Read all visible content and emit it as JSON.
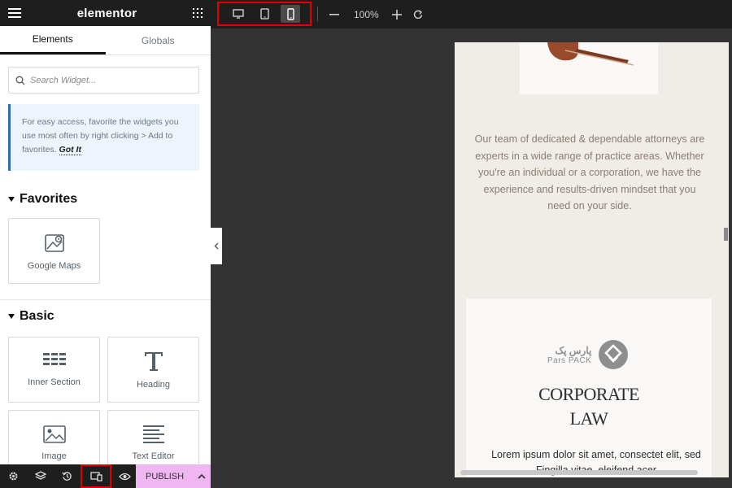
{
  "app": {
    "logo": "elementor"
  },
  "panel": {
    "tabs": [
      "Elements",
      "Globals"
    ],
    "search_placeholder": "Search Widget...",
    "notice": {
      "text": "For easy access, favorite the widgets you use most often by right clicking > Add to favorites.",
      "link": "Got It"
    },
    "favorites": {
      "title": "Favorites",
      "widgets": [
        {
          "label": "Google Maps",
          "icon": "google-maps-icon"
        }
      ]
    },
    "basic": {
      "title": "Basic",
      "widgets": [
        {
          "label": "Inner Section",
          "icon": "inner-section-icon"
        },
        {
          "label": "Heading",
          "icon": "heading-icon"
        },
        {
          "label": "Image",
          "icon": "image-icon"
        },
        {
          "label": "Text Editor",
          "icon": "text-editor-icon"
        }
      ]
    },
    "footer": {
      "icons": [
        "settings-icon",
        "layers-icon",
        "history-icon",
        "responsive-mode-icon",
        "preview-eye-icon"
      ],
      "publish_label": "PUBLISH"
    }
  },
  "toolbar": {
    "devices": [
      "desktop-icon",
      "tablet-icon",
      "mobile-icon"
    ],
    "active_device": "mobile",
    "zoom": "100%"
  },
  "preview": {
    "paragraph": "Our team of dedicated & dependable attorneys are experts in a wide range of practice areas. Whether you're an individual or a corporation, we have the experience and results-driven mindset that you need on your side.",
    "watermark": {
      "fa": "پارس پک",
      "en": "Pars PACK"
    },
    "heading_line1": "CORPORATE",
    "heading_line2": "LAW",
    "lorem": "Lorem ipsum dolor sit amet, consectet elit, sed Fingilla vitae, eleifend acer"
  },
  "colors": {
    "panel_dark": "#1e1e1e",
    "canvas": "#333333",
    "page_bg": "#f0ece8",
    "publish_bg": "#f0b6f1",
    "highlight": "#e00000",
    "notice_accent": "#2f6cb3"
  }
}
